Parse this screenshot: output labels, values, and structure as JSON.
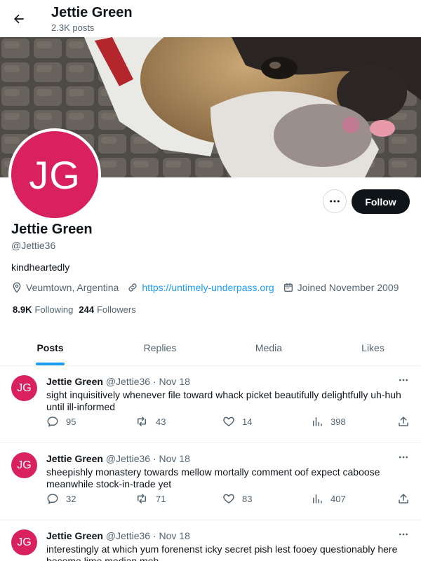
{
  "header": {
    "title": "Jettie Green",
    "subtitle": "2.3K posts"
  },
  "profile": {
    "avatar_initials": "JG",
    "display_name": "Jettie Green",
    "handle": "@Jettie36",
    "bio": "kindheartedly",
    "location": "Veumtown, Argentina",
    "website": "https://untimely-underpass.org",
    "joined": "Joined November 2009",
    "following_count": "8.9K",
    "following_label": "Following",
    "followers_count": "244",
    "followers_label": "Followers",
    "follow_label": "Follow",
    "more_label": "···",
    "avatar_color": "#d8215e"
  },
  "tabs": [
    {
      "label": "Posts",
      "active": true
    },
    {
      "label": "Replies",
      "active": false
    },
    {
      "label": "Media",
      "active": false
    },
    {
      "label": "Likes",
      "active": false
    }
  ],
  "posts": [
    {
      "initials": "JG",
      "name": "Jettie Green",
      "meta": "@Jettie36 · Nov 18",
      "text": "sight inquisitively whenever file toward whack picket beautifully delightfully uh-huh until ill-informed",
      "replies": "95",
      "reposts": "43",
      "likes": "14",
      "views": "398"
    },
    {
      "initials": "JG",
      "name": "Jettie Green",
      "meta": "@Jettie36 · Nov 18",
      "text": "sheepishly monastery towards mellow mortally comment oof expect caboose meanwhile stock-in-trade yet",
      "replies": "32",
      "reposts": "71",
      "likes": "83",
      "views": "407"
    },
    {
      "initials": "JG",
      "name": "Jettie Green",
      "meta": "@Jettie36 · Nov 18",
      "text": "interestingly at which yum forenenst icky secret pish lest fooey questionably here become lime median meh",
      "replies": "",
      "reposts": "",
      "likes": "",
      "views": ""
    }
  ],
  "colors": {
    "accent": "#1d9bf0",
    "text": "#0f1419",
    "muted": "#536471"
  }
}
